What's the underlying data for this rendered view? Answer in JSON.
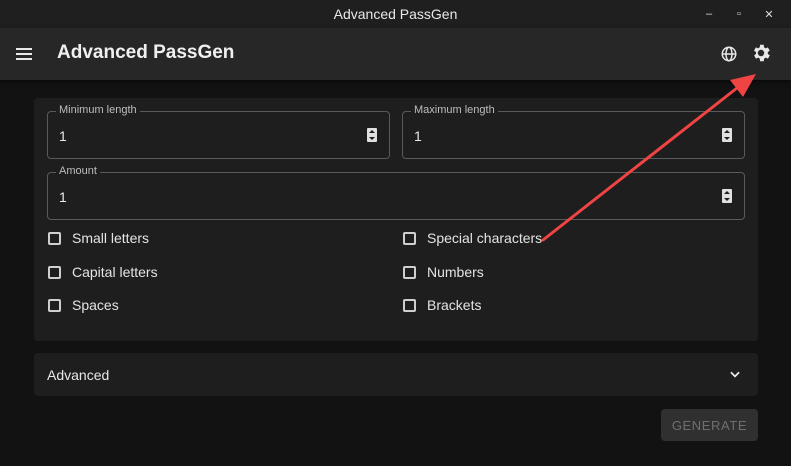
{
  "window": {
    "title": "Advanced PassGen",
    "minimize_glyph": "–",
    "maximize_glyph": "▫",
    "close_glyph": "✕"
  },
  "appbar": {
    "title": "Advanced PassGen",
    "menu_icon": "menu-icon",
    "language_icon": "globe-icon",
    "settings_icon": "gear-icon"
  },
  "form": {
    "min_length": {
      "label": "Minimum length",
      "value": "1"
    },
    "max_length": {
      "label": "Maximum length",
      "value": "1"
    },
    "amount": {
      "label": "Amount",
      "value": "1"
    },
    "options": {
      "small_letters": "Small letters",
      "capital_letters": "Capital letters",
      "spaces": "Spaces",
      "special_characters": "Special characters",
      "numbers": "Numbers",
      "brackets": "Brackets"
    }
  },
  "advanced": {
    "label": "Advanced",
    "icon": "chevron-down-icon"
  },
  "actions": {
    "generate_label": "GENERATE"
  },
  "colors": {
    "background": "#121212",
    "appbar": "#272727",
    "card": "#1e1e1e",
    "annotation_arrow": "#f04444"
  }
}
